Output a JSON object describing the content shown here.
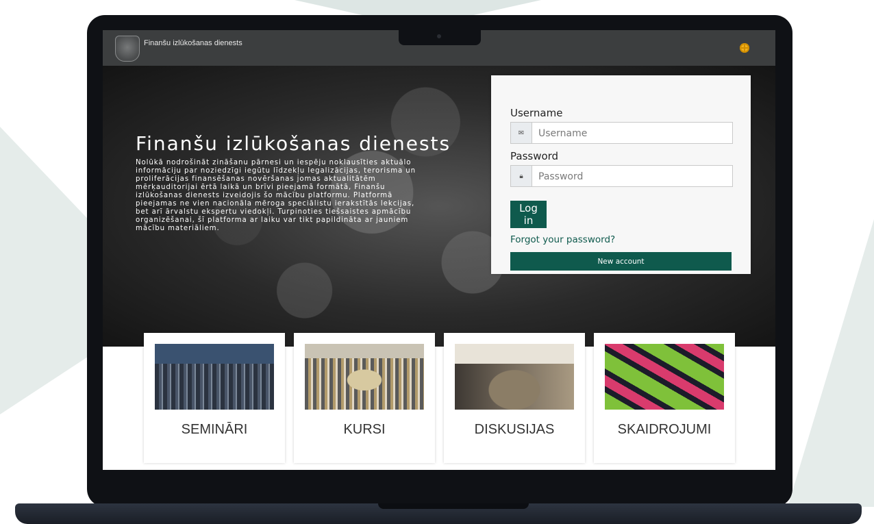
{
  "header": {
    "site_name": "Finanšu izlūkošanas dienests",
    "language_icon": "globe-icon"
  },
  "hero": {
    "title": "Finanšu izlūkošanas dienests",
    "description": "Nolūkā nodrošināt zināšanu pārnesi un iespēju noklausīties aktuālo informāciju par noziedzīgi iegūtu līdzekļu legalizācijas, terorisma un proliferācijas finansēšanas novēršanas jomas aktualitātēm mērķauditorijai ērtā laikā un brīvi pieejamā formātā, Finanšu izlūkošanas dienests izveidojis šo mācību platformu. Platformā pieejamas ne vien nacionāla mēroga speciālistu ierakstītās lekcijas, bet arī ārvalstu ekspertu viedokļi. Turpinoties tiešsaistes apmācību organizēšanai, šī platforma ar laiku var tikt papildināta ar jauniem mācību materiāliem."
  },
  "login": {
    "username_label": "Username",
    "username_placeholder": "Username",
    "username_value": "",
    "username_icon": "envelope-icon",
    "password_label": "Password",
    "password_placeholder": "Password",
    "password_value": "",
    "password_icon": "lock-icon",
    "login_button": "Log in",
    "forgot_link": "Forgot your password?",
    "new_account_button": "New account"
  },
  "categories": [
    {
      "label": "SEMINĀRI"
    },
    {
      "label": "KURSI"
    },
    {
      "label": "DISKUSIJAS"
    },
    {
      "label": "SKAIDROJUMI"
    }
  ],
  "colors": {
    "primary": "#0f5a4d",
    "navbar": "#3c3e3f",
    "accent_globe": "#f2b01e"
  }
}
